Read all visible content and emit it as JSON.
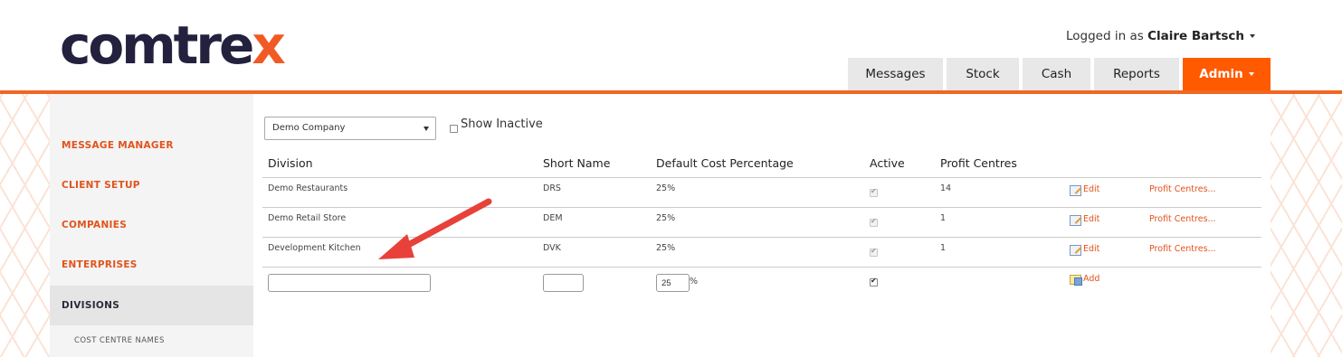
{
  "header": {
    "logo_text_a": "comtre",
    "logo_text_b": "x",
    "user_prefix": "Logged in as",
    "user_name": "Claire Bartsch"
  },
  "nav": {
    "messages": "Messages",
    "stock": "Stock",
    "cash": "Cash",
    "reports": "Reports",
    "admin": "Admin"
  },
  "sidebar": {
    "items": [
      {
        "label": "MESSAGE MANAGER"
      },
      {
        "label": "CLIENT SETUP"
      },
      {
        "label": "COMPANIES"
      },
      {
        "label": "ENTERPRISES"
      },
      {
        "label": "DIVISIONS"
      }
    ],
    "sub_items": [
      {
        "label": "COST CENTRE NAMES"
      }
    ]
  },
  "filters": {
    "company_select": "Demo Company",
    "show_inactive_label": "Show Inactive"
  },
  "table": {
    "headers": [
      "Division",
      "Short Name",
      "Default Cost Percentage",
      "Active",
      "Profit Centres"
    ],
    "rows": [
      {
        "division": "Demo Restaurants",
        "short": "DRS",
        "pct": "25%",
        "active": true,
        "profit_centres": "14",
        "edit": "Edit",
        "pc_link": "Profit Centres..."
      },
      {
        "division": "Demo Retail Store",
        "short": "DEM",
        "pct": "25%",
        "active": true,
        "profit_centres": "1",
        "edit": "Edit",
        "pc_link": "Profit Centres..."
      },
      {
        "division": "Development Kitchen",
        "short": "DVK",
        "pct": "25%",
        "active": true,
        "profit_centres": "1",
        "edit": "Edit",
        "pc_link": "Profit Centres..."
      }
    ],
    "new_row": {
      "division_value": "",
      "short_value": "",
      "pct_value": "25",
      "pct_suffix": "%",
      "active": true,
      "add": "Add"
    }
  },
  "colors": {
    "accent": "#f26522",
    "admin_tab": "#ff5a00",
    "logo_dark": "#23213d"
  }
}
